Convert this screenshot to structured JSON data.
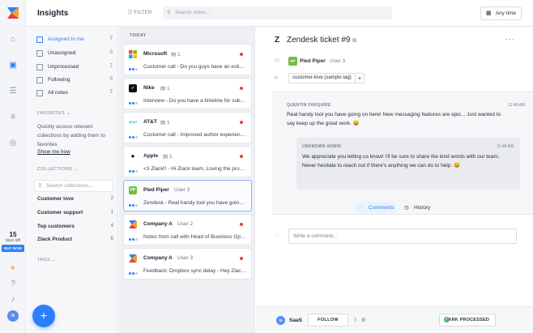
{
  "app": {
    "title": "Insights",
    "filter_label": "FILTER",
    "search_placeholder": "Search notes...",
    "time_filter": "Any time"
  },
  "rail": {
    "trial_days": "15",
    "trial_label": "days left",
    "buy_now": "BUY NOW",
    "user_initials": "N"
  },
  "sidebar": {
    "items": [
      {
        "label": "Assigned to me",
        "count": "7"
      },
      {
        "label": "Unassigned",
        "count": "0"
      },
      {
        "label": "Unprocessed",
        "count": "7"
      },
      {
        "label": "Following",
        "count": "0"
      },
      {
        "label": "All notes",
        "count": "7"
      }
    ],
    "favorites_head": "FAVORITES",
    "favorites_text": "Quickly access relevant collections by adding them to favorites",
    "show_me_how": "Show me how",
    "collections_head": "COLLECTIONS",
    "collections_search": "Search collections...",
    "collections": [
      {
        "label": "Customer love",
        "count": "2"
      },
      {
        "label": "Customer support",
        "count": "1"
      },
      {
        "label": "Top customers",
        "count": "4"
      },
      {
        "label": "Zlack Product",
        "count": "6"
      }
    ],
    "tags_head": "TAGS"
  },
  "list": {
    "group": "TODAY",
    "cards": [
      {
        "name": "Microsoft",
        "meta": "1",
        "text": "Customer call - Do you guys have an estima..."
      },
      {
        "name": "Nike",
        "meta": "1",
        "text": "Interview - Do you have a timeline for submi..."
      },
      {
        "name": "AT&T",
        "meta": "1",
        "text": "Customer call - Improved author experience..."
      },
      {
        "name": "Apple",
        "meta": "1",
        "text": "<3 Zlack!! - Hi Zlack team, Loving the produ..."
      },
      {
        "name": "Pied Piper",
        "meta": "User 3",
        "text": "Zendesk - Real handy tool you have going o..."
      },
      {
        "name": "Company A",
        "meta": "User 2",
        "text": "Notes from call with Head of Business Oper..."
      },
      {
        "name": "Company A",
        "meta": "User 3",
        "text": "Feedback: Dropbox sync delay - Hey Zlack t..."
      }
    ]
  },
  "detail": {
    "title": "Zendesk ticket #9",
    "company": "Pied Piper",
    "company_badge": "PP",
    "user": "User 3",
    "tag": "customer-love (sample tag)",
    "messages": [
      {
        "author": "QUENTIN FARQUIRE",
        "time": "11:48 AM",
        "body": "Real handy tool you have going on here! New messaging features are epic... Just wanted to say keep up the great work. 😀"
      },
      {
        "author": "UNKNOWN ADMIN",
        "time": "11:48 AM",
        "body": "We appreciate you letting us know! I'll be sure to share the kind words with our team. Never hesitate to reach out if there's anything we can do to help. 😀"
      }
    ],
    "tab_comments": "Comments",
    "tab_history": "History",
    "comment_placeholder": "Write a comment...",
    "footer": {
      "initials": "SI",
      "assignee": "SaaS",
      "follow": "FOLLOW",
      "attachments": "0",
      "mark_processed": "MARK PROCESSED"
    }
  },
  "colors": {
    "accent": "#2d7ff9",
    "unread_dot": "#e5413d",
    "pied_piper": "#6fbe3f"
  }
}
